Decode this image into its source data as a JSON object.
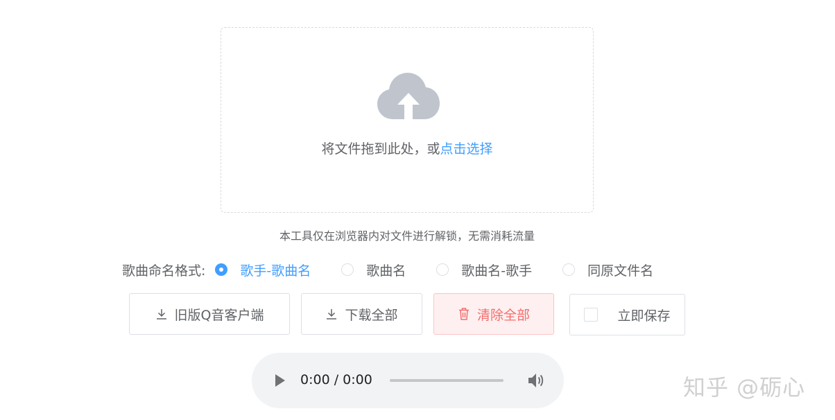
{
  "upload": {
    "icon": "cloud-upload-icon",
    "drag_text": "将文件拖到此处，或",
    "click_text": "点击选择"
  },
  "tip": "本工具仅在浏览器内对文件进行解锁，无需消耗流量",
  "naming": {
    "label": "歌曲命名格式:",
    "selected": "歌手-歌曲名",
    "options": [
      {
        "label": "歌手-歌曲名",
        "checked": true
      },
      {
        "label": "歌曲名",
        "checked": false
      },
      {
        "label": "歌曲名-歌手",
        "checked": false
      },
      {
        "label": "同原文件名",
        "checked": false
      }
    ]
  },
  "buttons": {
    "legacy_client": "旧版Q音客户端",
    "download_all": "下载全部",
    "clear_all": "清除全部",
    "save_now": "立即保存"
  },
  "player": {
    "time": "0:00 / 0:00",
    "progress": 0
  },
  "watermark": "知乎 @砺心",
  "colors": {
    "primary": "#409eff",
    "danger": "#f56c6c",
    "danger_bg": "#fef0f0",
    "text": "#606266",
    "border": "#dcdfe6",
    "player_bg": "#f1f3f4"
  }
}
